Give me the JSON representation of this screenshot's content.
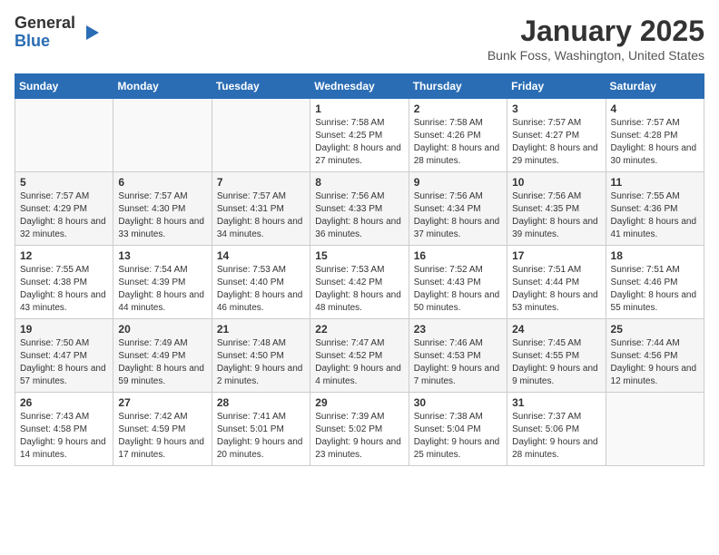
{
  "logo": {
    "general": "General",
    "blue": "Blue"
  },
  "header": {
    "month": "January 2025",
    "location": "Bunk Foss, Washington, United States"
  },
  "weekdays": [
    "Sunday",
    "Monday",
    "Tuesday",
    "Wednesday",
    "Thursday",
    "Friday",
    "Saturday"
  ],
  "weeks": [
    [
      {
        "day": "",
        "sunrise": "",
        "sunset": "",
        "daylight": ""
      },
      {
        "day": "",
        "sunrise": "",
        "sunset": "",
        "daylight": ""
      },
      {
        "day": "",
        "sunrise": "",
        "sunset": "",
        "daylight": ""
      },
      {
        "day": "1",
        "sunrise": "Sunrise: 7:58 AM",
        "sunset": "Sunset: 4:25 PM",
        "daylight": "Daylight: 8 hours and 27 minutes."
      },
      {
        "day": "2",
        "sunrise": "Sunrise: 7:58 AM",
        "sunset": "Sunset: 4:26 PM",
        "daylight": "Daylight: 8 hours and 28 minutes."
      },
      {
        "day": "3",
        "sunrise": "Sunrise: 7:57 AM",
        "sunset": "Sunset: 4:27 PM",
        "daylight": "Daylight: 8 hours and 29 minutes."
      },
      {
        "day": "4",
        "sunrise": "Sunrise: 7:57 AM",
        "sunset": "Sunset: 4:28 PM",
        "daylight": "Daylight: 8 hours and 30 minutes."
      }
    ],
    [
      {
        "day": "5",
        "sunrise": "Sunrise: 7:57 AM",
        "sunset": "Sunset: 4:29 PM",
        "daylight": "Daylight: 8 hours and 32 minutes."
      },
      {
        "day": "6",
        "sunrise": "Sunrise: 7:57 AM",
        "sunset": "Sunset: 4:30 PM",
        "daylight": "Daylight: 8 hours and 33 minutes."
      },
      {
        "day": "7",
        "sunrise": "Sunrise: 7:57 AM",
        "sunset": "Sunset: 4:31 PM",
        "daylight": "Daylight: 8 hours and 34 minutes."
      },
      {
        "day": "8",
        "sunrise": "Sunrise: 7:56 AM",
        "sunset": "Sunset: 4:33 PM",
        "daylight": "Daylight: 8 hours and 36 minutes."
      },
      {
        "day": "9",
        "sunrise": "Sunrise: 7:56 AM",
        "sunset": "Sunset: 4:34 PM",
        "daylight": "Daylight: 8 hours and 37 minutes."
      },
      {
        "day": "10",
        "sunrise": "Sunrise: 7:56 AM",
        "sunset": "Sunset: 4:35 PM",
        "daylight": "Daylight: 8 hours and 39 minutes."
      },
      {
        "day": "11",
        "sunrise": "Sunrise: 7:55 AM",
        "sunset": "Sunset: 4:36 PM",
        "daylight": "Daylight: 8 hours and 41 minutes."
      }
    ],
    [
      {
        "day": "12",
        "sunrise": "Sunrise: 7:55 AM",
        "sunset": "Sunset: 4:38 PM",
        "daylight": "Daylight: 8 hours and 43 minutes."
      },
      {
        "day": "13",
        "sunrise": "Sunrise: 7:54 AM",
        "sunset": "Sunset: 4:39 PM",
        "daylight": "Daylight: 8 hours and 44 minutes."
      },
      {
        "day": "14",
        "sunrise": "Sunrise: 7:53 AM",
        "sunset": "Sunset: 4:40 PM",
        "daylight": "Daylight: 8 hours and 46 minutes."
      },
      {
        "day": "15",
        "sunrise": "Sunrise: 7:53 AM",
        "sunset": "Sunset: 4:42 PM",
        "daylight": "Daylight: 8 hours and 48 minutes."
      },
      {
        "day": "16",
        "sunrise": "Sunrise: 7:52 AM",
        "sunset": "Sunset: 4:43 PM",
        "daylight": "Daylight: 8 hours and 50 minutes."
      },
      {
        "day": "17",
        "sunrise": "Sunrise: 7:51 AM",
        "sunset": "Sunset: 4:44 PM",
        "daylight": "Daylight: 8 hours and 53 minutes."
      },
      {
        "day": "18",
        "sunrise": "Sunrise: 7:51 AM",
        "sunset": "Sunset: 4:46 PM",
        "daylight": "Daylight: 8 hours and 55 minutes."
      }
    ],
    [
      {
        "day": "19",
        "sunrise": "Sunrise: 7:50 AM",
        "sunset": "Sunset: 4:47 PM",
        "daylight": "Daylight: 8 hours and 57 minutes."
      },
      {
        "day": "20",
        "sunrise": "Sunrise: 7:49 AM",
        "sunset": "Sunset: 4:49 PM",
        "daylight": "Daylight: 8 hours and 59 minutes."
      },
      {
        "day": "21",
        "sunrise": "Sunrise: 7:48 AM",
        "sunset": "Sunset: 4:50 PM",
        "daylight": "Daylight: 9 hours and 2 minutes."
      },
      {
        "day": "22",
        "sunrise": "Sunrise: 7:47 AM",
        "sunset": "Sunset: 4:52 PM",
        "daylight": "Daylight: 9 hours and 4 minutes."
      },
      {
        "day": "23",
        "sunrise": "Sunrise: 7:46 AM",
        "sunset": "Sunset: 4:53 PM",
        "daylight": "Daylight: 9 hours and 7 minutes."
      },
      {
        "day": "24",
        "sunrise": "Sunrise: 7:45 AM",
        "sunset": "Sunset: 4:55 PM",
        "daylight": "Daylight: 9 hours and 9 minutes."
      },
      {
        "day": "25",
        "sunrise": "Sunrise: 7:44 AM",
        "sunset": "Sunset: 4:56 PM",
        "daylight": "Daylight: 9 hours and 12 minutes."
      }
    ],
    [
      {
        "day": "26",
        "sunrise": "Sunrise: 7:43 AM",
        "sunset": "Sunset: 4:58 PM",
        "daylight": "Daylight: 9 hours and 14 minutes."
      },
      {
        "day": "27",
        "sunrise": "Sunrise: 7:42 AM",
        "sunset": "Sunset: 4:59 PM",
        "daylight": "Daylight: 9 hours and 17 minutes."
      },
      {
        "day": "28",
        "sunrise": "Sunrise: 7:41 AM",
        "sunset": "Sunset: 5:01 PM",
        "daylight": "Daylight: 9 hours and 20 minutes."
      },
      {
        "day": "29",
        "sunrise": "Sunrise: 7:39 AM",
        "sunset": "Sunset: 5:02 PM",
        "daylight": "Daylight: 9 hours and 23 minutes."
      },
      {
        "day": "30",
        "sunrise": "Sunrise: 7:38 AM",
        "sunset": "Sunset: 5:04 PM",
        "daylight": "Daylight: 9 hours and 25 minutes."
      },
      {
        "day": "31",
        "sunrise": "Sunrise: 7:37 AM",
        "sunset": "Sunset: 5:06 PM",
        "daylight": "Daylight: 9 hours and 28 minutes."
      },
      {
        "day": "",
        "sunrise": "",
        "sunset": "",
        "daylight": ""
      }
    ]
  ]
}
